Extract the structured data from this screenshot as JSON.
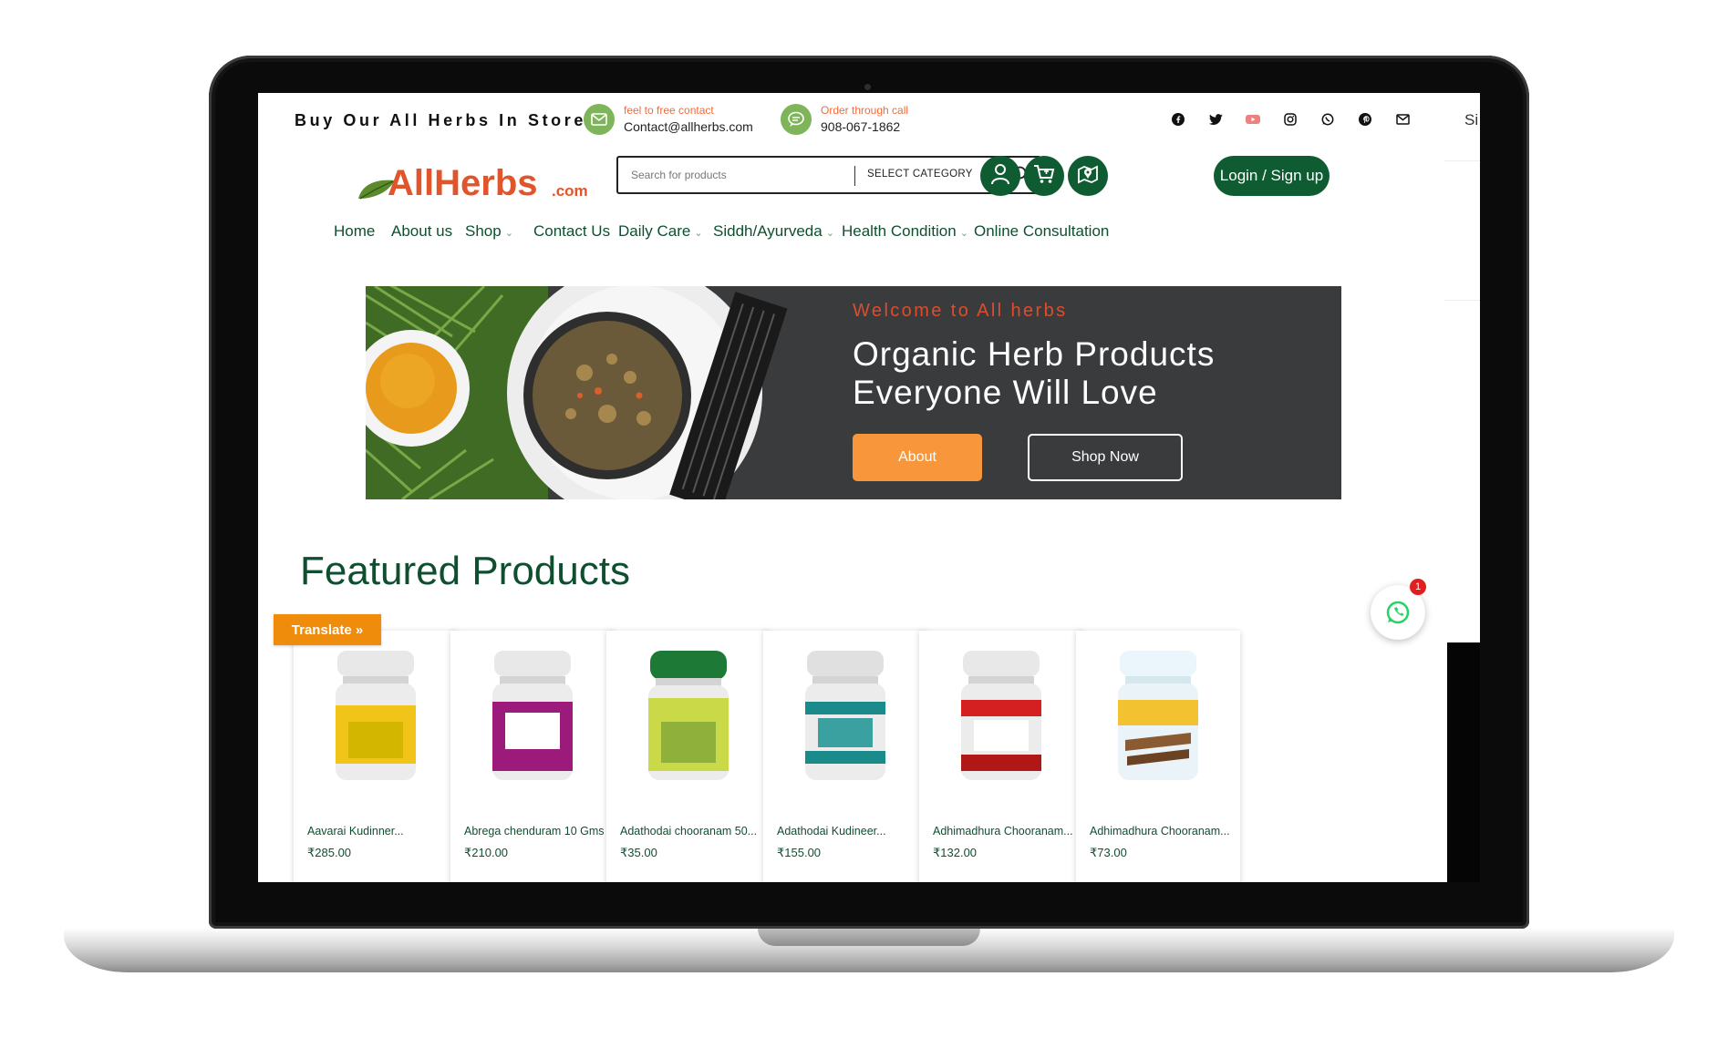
{
  "topbar": {
    "tagline": "Buy Our All Herbs In Store",
    "email_label": "feel to free contact",
    "email_value": "Contact@allherbs.com",
    "phone_label": "Order through call",
    "phone_value": "908-067-1862",
    "signin_cut": "Si",
    "social_icons": [
      "facebook-icon",
      "twitter-icon",
      "youtube-icon",
      "instagram-icon",
      "whatsapp-icon",
      "pinterest-icon",
      "mail-icon"
    ]
  },
  "header": {
    "logo_main": "AllHerbs",
    "logo_suffix": ".com",
    "search_placeholder": "Search for products",
    "select_category": "SELECT CATEGORY",
    "login_label": "Login / Sign up"
  },
  "nav": [
    {
      "label": "Home"
    },
    {
      "label": "About us"
    },
    {
      "label": "Shop"
    },
    {
      "label": "Contact Us"
    },
    {
      "label": "Daily Care"
    },
    {
      "label": "Siddh/Ayurveda"
    },
    {
      "label": "Health Condition"
    },
    {
      "label": "Online Consultation"
    }
  ],
  "hero": {
    "welcome": "Welcome to All herbs",
    "title_line1": "Organic Herb Products",
    "title_line2": "Everyone Will Love",
    "about_btn": "About",
    "shop_btn": "Shop Now"
  },
  "featured_title": "Featured Products",
  "translate_label": "Translate »",
  "whatsapp_badge": "1",
  "products": [
    {
      "name": "Aavarai Kudinner...",
      "price": "₹285.00",
      "label_color": "#f0c419",
      "cap_color": "#e8e8e8",
      "art_color": "#d2b600"
    },
    {
      "name": "Abrega chenduram 10 Gms",
      "price": "₹210.00",
      "label_color": "#9b1a7a",
      "cap_color": "#e8e8e8",
      "art_color": "#c23c9a"
    },
    {
      "name": "Adathodai chooranam 50...",
      "price": "₹35.00",
      "label_color": "#c9d948",
      "cap_color": "#1c7a36",
      "art_color": "#8fb03a"
    },
    {
      "name": "Adathodai Kudineer...",
      "price": "₹155.00",
      "label_color": "#1a8a8a",
      "cap_color": "#e0e0e0",
      "art_color": "#3aa0a0"
    },
    {
      "name": "Adhimadhura Chooranam...",
      "price": "₹132.00",
      "label_color": "#d42020",
      "cap_color": "#e8e8e8",
      "art_color": "#b01818"
    },
    {
      "name": "Adhimadhura Chooranam...",
      "price": "₹73.00",
      "label_color": "#f2c230",
      "cap_color": "#eaf6fb",
      "art_color": "#8a5a32"
    }
  ]
}
